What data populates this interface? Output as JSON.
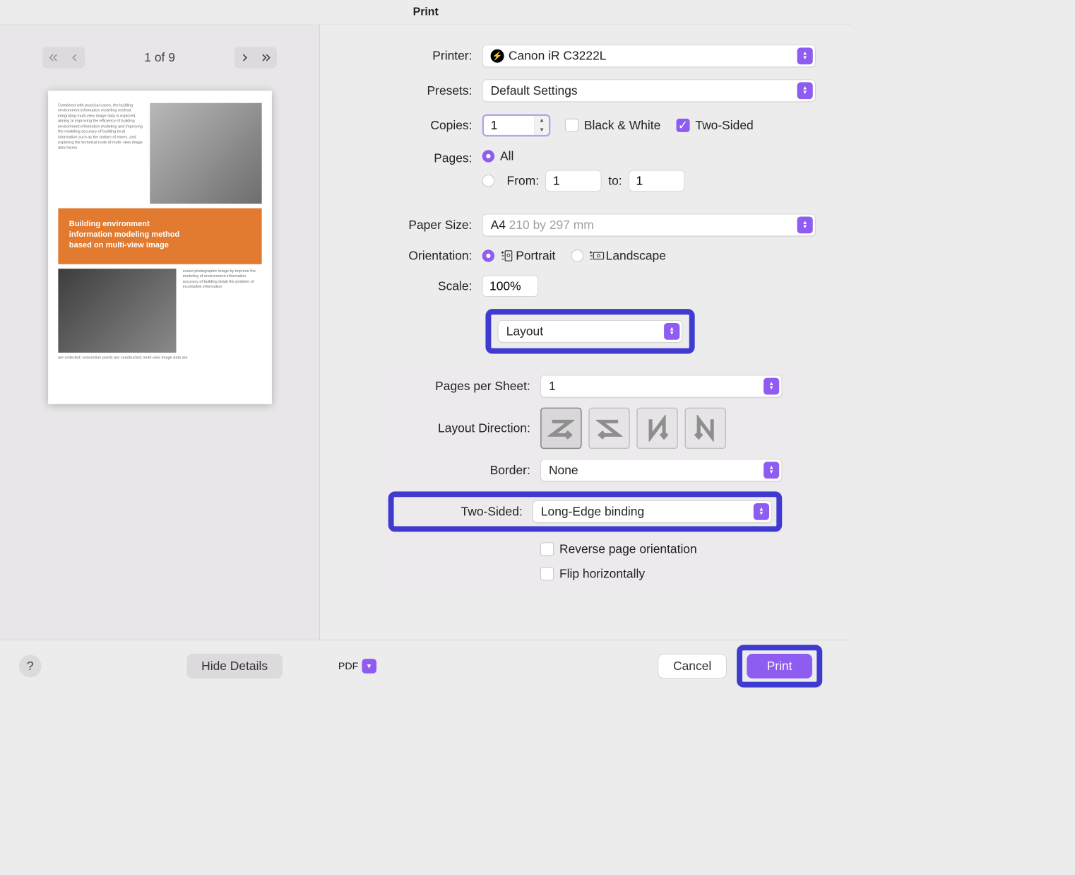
{
  "window": {
    "title": "Print"
  },
  "preview": {
    "counter": "1 of 9",
    "doc_title_line1": "Building environment",
    "doc_title_line2": "information modeling method",
    "doc_title_line3": "based on multi-view image",
    "blurb1": "Combined with practical cases, the building environment information modeling method integrating multi-view image data is explored, aiming at improving the efficiency of building environment information modeling and improving the modeling accuracy of building local information such as the bottom of eaves, and exploring the technical route of multi- view image data fusion.",
    "blurb2": "sound photographic image by improve the modeling of environment information accuracy of building detail  the problem of incomplete information",
    "blurb3": "are collected; connection points are constructed; multi-view image data are"
  },
  "settings": {
    "printer_label": "Printer:",
    "printer_value": "Canon iR C3222L",
    "presets_label": "Presets:",
    "presets_value": "Default Settings",
    "copies_label": "Copies:",
    "copies_value": "1",
    "bw_label": "Black & White",
    "twosided_label": "Two-Sided",
    "pages_label": "Pages:",
    "pages_all": "All",
    "pages_from_label": "From:",
    "pages_from_value": "1",
    "pages_to_label": "to:",
    "pages_to_value": "1",
    "papersize_label": "Paper Size:",
    "papersize_prefix": "A4",
    "papersize_dim": "210 by 297 mm",
    "orientation_label": "Orientation:",
    "orientation_portrait": "Portrait",
    "orientation_landscape": "Landscape",
    "scale_label": "Scale:",
    "scale_value": "100%",
    "section_select": "Layout",
    "pps_label": "Pages per Sheet:",
    "pps_value": "1",
    "layoutdir_label": "Layout Direction:",
    "border_label": "Border:",
    "border_value": "None",
    "twosided_row_label": "Two-Sided:",
    "twosided_row_value": "Long-Edge binding",
    "reverse_label": "Reverse page orientation",
    "flip_label": "Flip horizontally"
  },
  "footer": {
    "help": "?",
    "hide_details": "Hide Details",
    "pdf": "PDF",
    "cancel": "Cancel",
    "print": "Print"
  }
}
